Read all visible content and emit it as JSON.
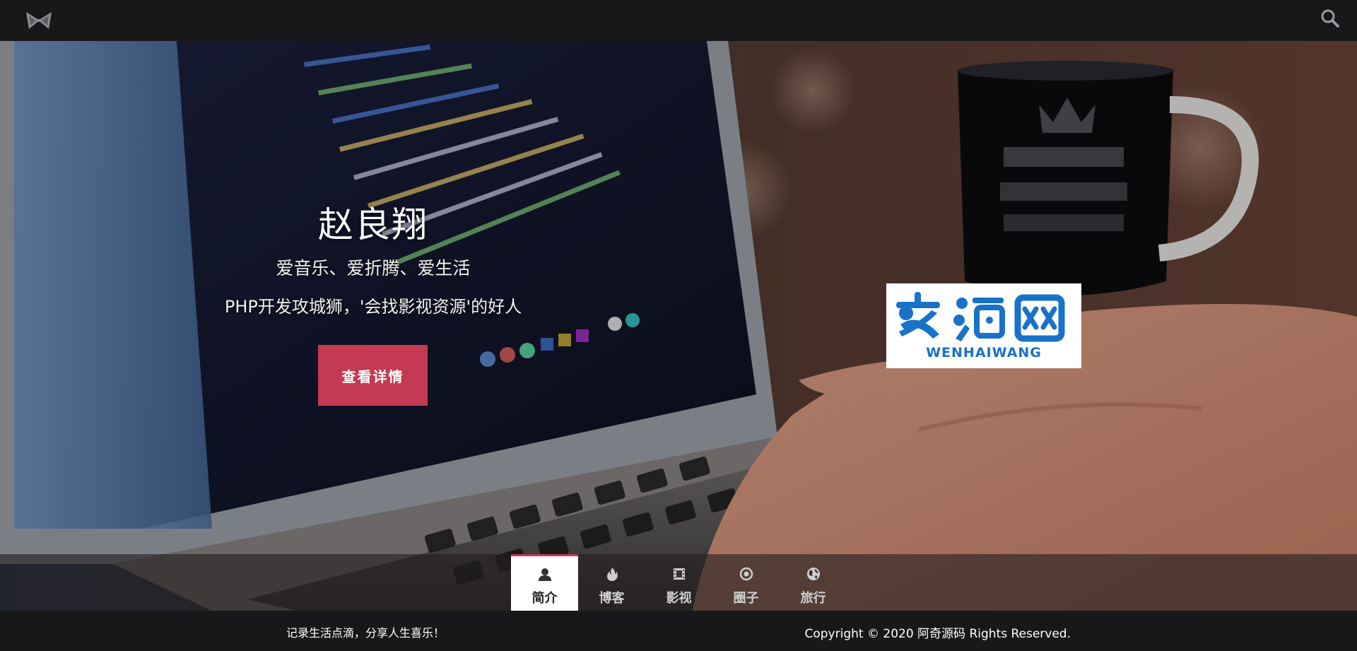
{
  "topbar": {
    "logo_icon": "bow-logo-icon",
    "search_icon": "search-icon"
  },
  "hero": {
    "title": "赵良翔",
    "subtitle": "爱音乐、爱折腾、爱生活",
    "tagline": "PHP开发攻城狮，'会找影视资源'的好人",
    "cta_label": "查看详情",
    "accent_color": "#c33a52",
    "watermark": {
      "brand": "文海网",
      "brand_latin": "WENHAIWANG",
      "color": "#1872c8"
    }
  },
  "tabs": [
    {
      "label": "简介",
      "icon": "user-icon",
      "active": true
    },
    {
      "label": "博客",
      "icon": "fire-icon",
      "active": false
    },
    {
      "label": "影视",
      "icon": "film-icon",
      "active": false
    },
    {
      "label": "圈子",
      "icon": "target-icon",
      "active": false
    },
    {
      "label": "旅行",
      "icon": "globe-icon",
      "active": false
    }
  ],
  "footer": {
    "slogan": "记录生活点滴，分享人生喜乐！",
    "copyright": "Copyright © 2020 阿奇源码 Rights Reserved."
  }
}
